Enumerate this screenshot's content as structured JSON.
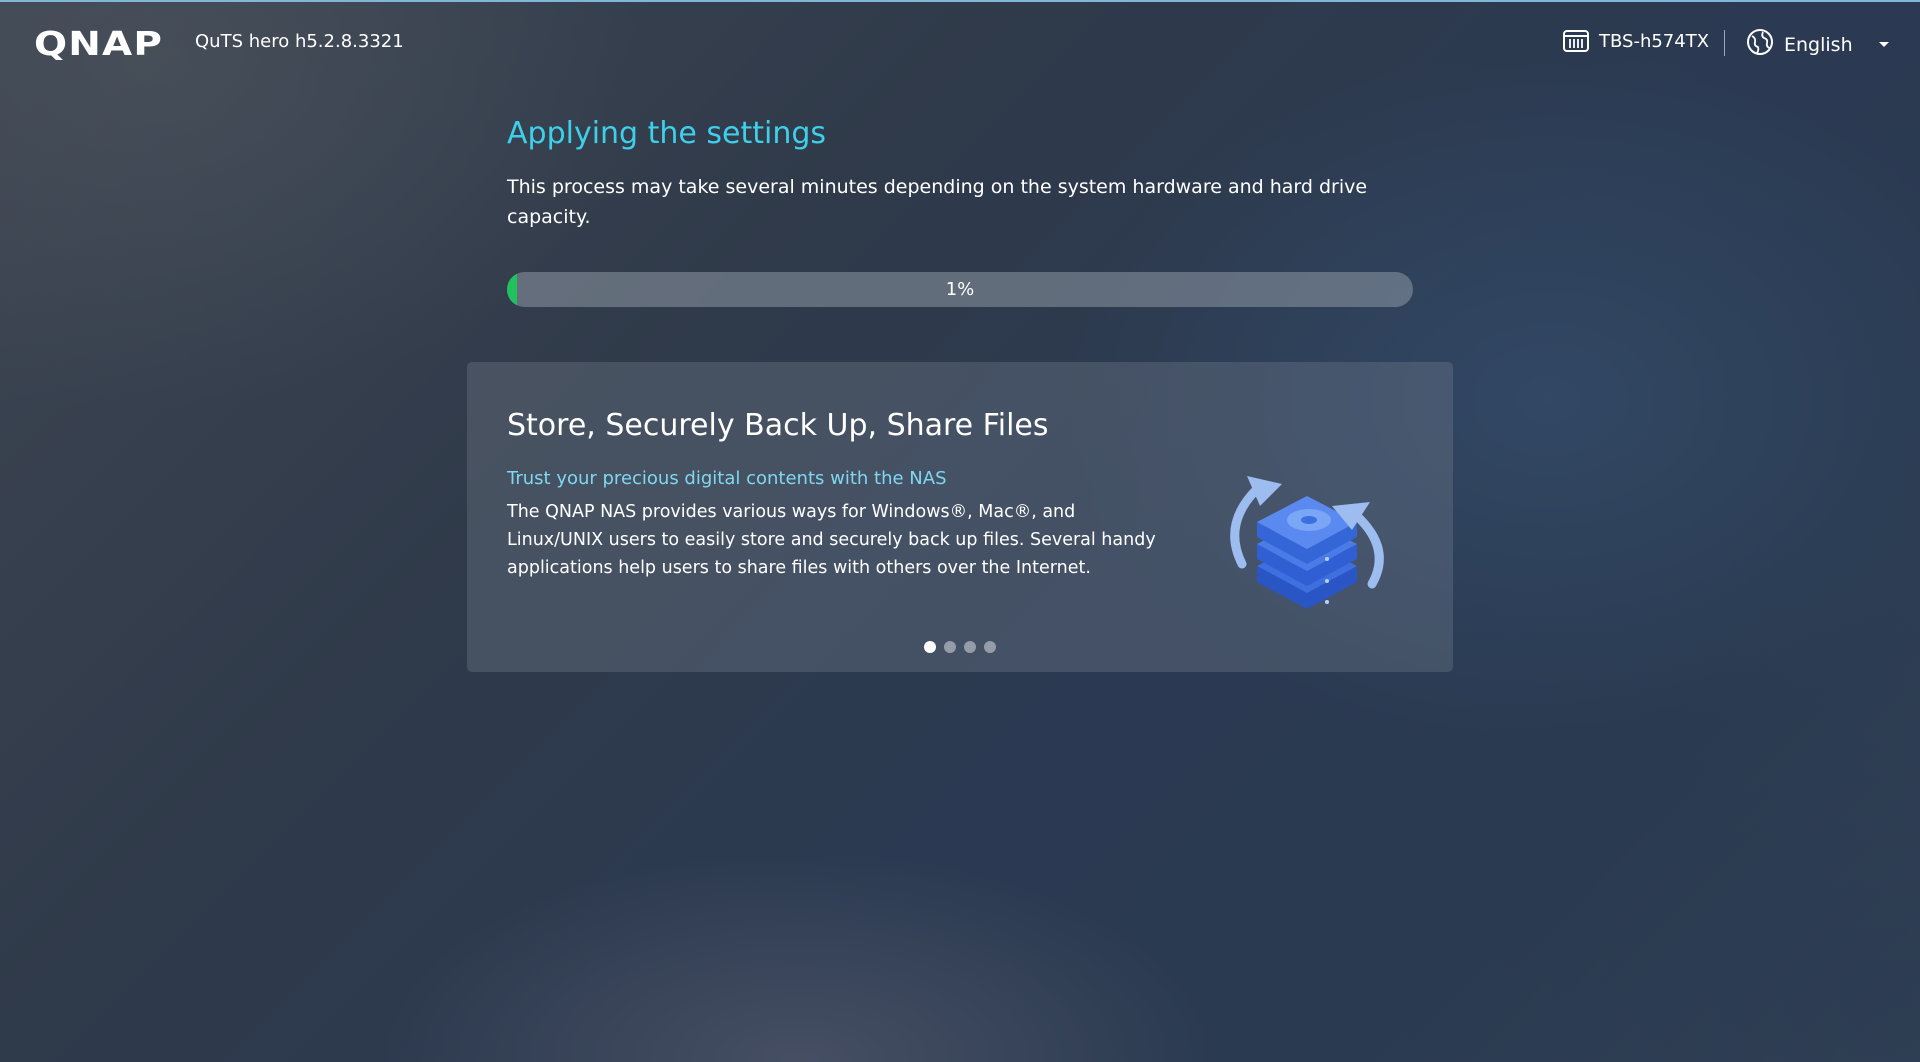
{
  "header": {
    "logo": "QNAP",
    "version": "QuTS hero h5.2.8.3321",
    "device_name": "TBS-h574TX",
    "device_icon": "nas-device-icon",
    "language": "English",
    "language_icon": "globe-icon"
  },
  "main": {
    "title": "Applying the settings",
    "description": "This process may take several minutes depending on the system hardware and hard drive capacity.",
    "progress": {
      "value_percent": 1,
      "label": "1%",
      "color": "#21c25e"
    }
  },
  "card": {
    "title": "Store, Securely Back Up, Share Files",
    "subtitle": "Trust your precious digital contents with the NAS",
    "body": "The QNAP NAS provides various ways for Windows®, Mac®, and Linux/UNIX users to easily store and securely back up files. Several handy applications help users to share files with others over the Internet.",
    "illustration_icon": "nas-backup-illustration",
    "carousel": {
      "count": 4,
      "active_index": 0
    }
  },
  "colors": {
    "accent": "#3ed0ea",
    "subtitle": "#7fd8f0"
  }
}
